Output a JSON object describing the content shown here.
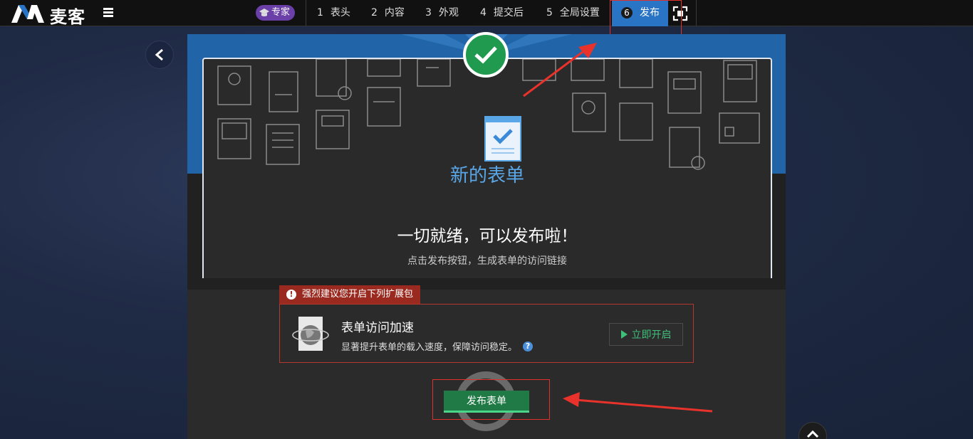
{
  "header": {
    "brand": "麦客",
    "expert_badge": "专家",
    "steps": [
      {
        "num": "1",
        "label": "表头"
      },
      {
        "num": "2",
        "label": "内容"
      },
      {
        "num": "3",
        "label": "外观"
      },
      {
        "num": "4",
        "label": "提交后"
      },
      {
        "num": "5",
        "label": "全局设置"
      },
      {
        "num": "6",
        "label": "发布"
      }
    ]
  },
  "main": {
    "form_title": "新的表单",
    "ready_title": "一切就绪，可以发布啦！",
    "ready_subtitle": "点击发布按钮，生成表单的访问链接"
  },
  "extension": {
    "tab_label": "强烈建议您开启下列扩展包",
    "name": "表单访问加速",
    "description": "显著提升表单的载入速度，保障访问稳定。",
    "enable_label": "立即开启"
  },
  "publish": {
    "button_label": "发布表单"
  },
  "colors": {
    "active_step": "#2a74c6",
    "publish_green": "#1f7a45",
    "warning_red": "#9a2a20",
    "highlight_red": "#e0322b"
  }
}
